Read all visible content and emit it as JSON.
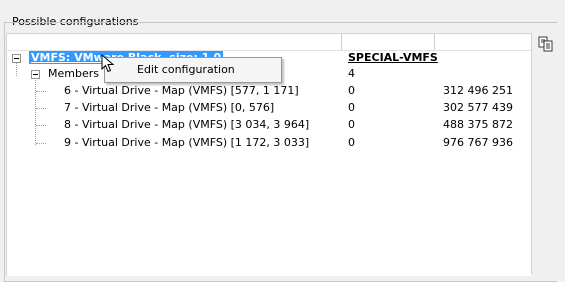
{
  "group_title": "Possible configurations",
  "tree": {
    "root": {
      "label": "VMFS: VMware Black, size: 1.0",
      "type": "SPECIAL-VMFS",
      "size": ""
    },
    "members": {
      "label": "Members",
      "count": "4"
    },
    "drives": [
      {
        "label": "6 - Virtual Drive - Map (VMFS) [577, 1 171]",
        "value": "0",
        "size": "312 496 251"
      },
      {
        "label": "7 - Virtual Drive - Map (VMFS) [0, 576]",
        "value": "0",
        "size": "302 577 439"
      },
      {
        "label": "8 - Virtual Drive - Map (VMFS) [3 034, 3 964]",
        "value": "0",
        "size": "488 375 872"
      },
      {
        "label": "9 - Virtual Drive - Map (VMFS) [1 172, 3 033]",
        "value": "0",
        "size": "976 767 936"
      }
    ]
  },
  "context_menu": {
    "items": [
      {
        "label": "Edit configuration"
      }
    ]
  },
  "icons": {
    "copy": "copy-icon",
    "cursor": "mouse-pointer-icon",
    "expander": "collapse-minus-icon"
  }
}
